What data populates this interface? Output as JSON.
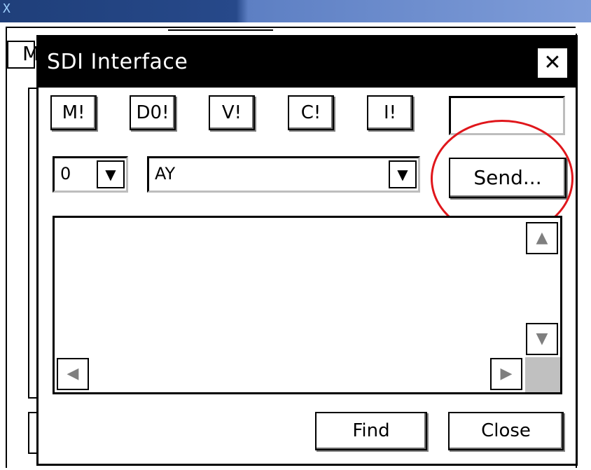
{
  "host": {
    "title_glyph": "X",
    "tab_label": "M"
  },
  "dialog": {
    "title": "SDI Interface",
    "close_glyph": "✕"
  },
  "commands": [
    "M!",
    "D0!",
    "V!",
    "C!",
    "I!"
  ],
  "address_select": {
    "value": "0"
  },
  "command_select": {
    "value": "AY"
  },
  "send_label": "Send...",
  "highlight_color": "#e0161b",
  "footer": {
    "find_label": "Find",
    "close_label": "Close"
  },
  "icons": {
    "dropdown": "chevron-down-icon",
    "scroll_up": "scroll-up-icon",
    "scroll_down": "scroll-down-icon",
    "scroll_left": "scroll-left-icon",
    "scroll_right": "scroll-right-icon"
  }
}
